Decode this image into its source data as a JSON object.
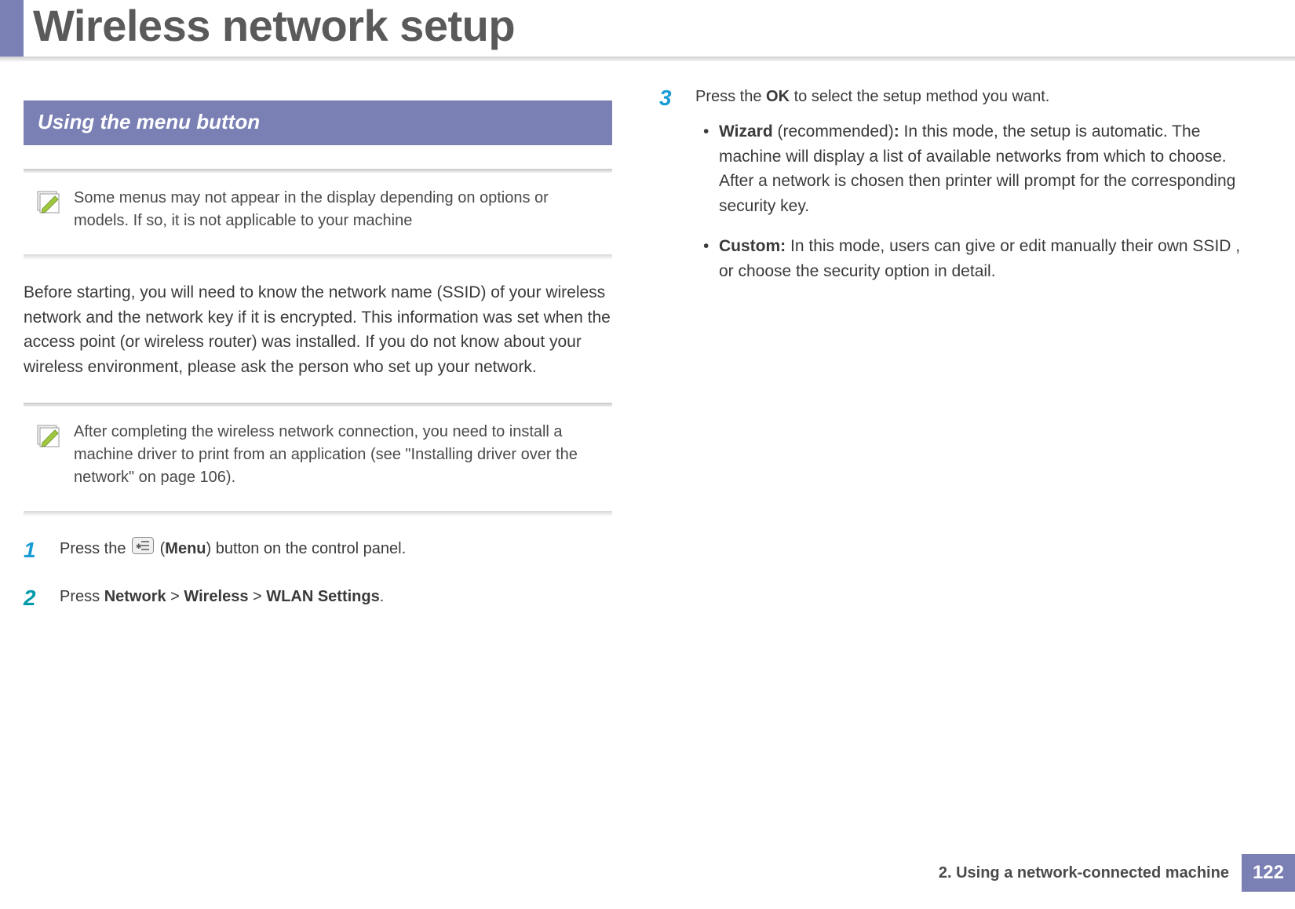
{
  "header": {
    "title": "Wireless network setup"
  },
  "section": {
    "heading": "Using the menu button"
  },
  "notes": {
    "note1": "Some menus may not appear in the display depending on options or models. If so, it is not applicable to your machine",
    "note2": "After completing the wireless network connection, you need to install a machine driver to print from an application (see \"Installing driver over the network\" on page 106)."
  },
  "body": {
    "intro": "Before starting, you will need to know the network name (SSID) of your wireless network and the network key if it is encrypted. This information was set when the access point (or wireless router) was installed. If you do not know about your wireless environment, please ask the person who set up your network."
  },
  "steps": {
    "s1": {
      "num": "1",
      "pre": "Press the ",
      "menu_label": "Menu",
      "post": ") button on the control panel."
    },
    "s2": {
      "num": "2",
      "pre": "Press ",
      "p1": "Network",
      "gt1": " > ",
      "p2": "Wireless",
      "gt2": " > ",
      "p3": "WLAN Settings",
      "dot": "."
    },
    "s3": {
      "num": "3",
      "pre": "Press the ",
      "ok": "OK",
      "post": " to select the setup method you want."
    }
  },
  "bullets": {
    "b1": {
      "t1": "Wizard",
      "t2": " (recommended)",
      "t3": ":",
      "rest": " In this mode, the setup is automatic. The machine will display a list of available networks from which to choose. After a network is chosen then printer will prompt for the corresponding security key."
    },
    "b2": {
      "t1": "Custom:",
      "rest": " In this mode, users can give or edit manually their own SSID , or choose the security option in detail."
    }
  },
  "footer": {
    "chapter": "2.  Using a network-connected machine",
    "page": "122"
  }
}
